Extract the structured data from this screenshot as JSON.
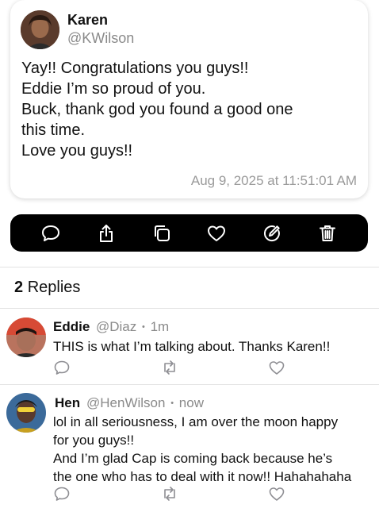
{
  "post": {
    "author_name": "Karen",
    "author_handle": "@KWilson",
    "lines": [
      "Yay!! Congratulations you guys!!",
      "Eddie I’m so proud of you.",
      "Buck, thank god you found a good one",
      "this time.",
      "Love you guys!!"
    ],
    "timestamp": "Aug 9, 2025 at 11:51:01 AM"
  },
  "toolbar": {
    "icons": [
      "reply-icon",
      "share-icon",
      "copy-icon",
      "like-icon",
      "edit-icon",
      "delete-icon"
    ]
  },
  "replies_section": {
    "count": "2",
    "label": "Replies"
  },
  "replies": [
    {
      "name": "Eddie",
      "handle": "@Diaz",
      "separator": "•",
      "time": "1m",
      "lines": [
        "THIS is what I’m talking about. Thanks Karen!!"
      ]
    },
    {
      "name": "Hen",
      "handle": "@HenWilson",
      "separator": "•",
      "time": "now",
      "lines": [
        "lol in all seriousness, I am over the moon happy",
        "for you guys!!",
        "And I’m glad Cap is coming back because he’s",
        "the one who has to deal with it now!! Hahahahaha"
      ]
    }
  ],
  "colors": {
    "toolbar_bg": "#000000",
    "secondary_text": "#8a8a8a",
    "reply_action_icon": "#8e8e93"
  }
}
